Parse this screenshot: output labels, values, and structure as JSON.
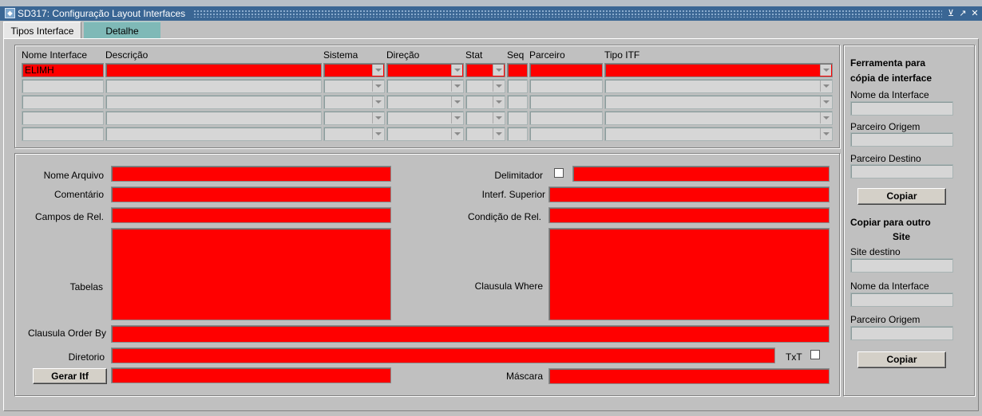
{
  "window": {
    "title": "SD317: Configuração Layout Interfaces"
  },
  "tabs": [
    {
      "label": "Tipos Interface"
    },
    {
      "label": "Detalhe"
    }
  ],
  "grid": {
    "columns": [
      "Nome Interface",
      "Descrição",
      "Sistema",
      "Direção",
      "Stat",
      "Seq",
      "Parceiro",
      "Tipo ITF"
    ],
    "first_row": {
      "nome_interface": "ELIMH"
    }
  },
  "detail": {
    "nome_arquivo_label": "Nome Arquivo",
    "comentario_label": "Comentário",
    "campos_rel_label": "Campos de Rel.",
    "tabelas_label": "Tabelas",
    "order_by_label": "Clausula Order By",
    "diretorio_label": "Diretorio",
    "gerar_button": "Gerar Itf",
    "delimitador_label": "Delimitador",
    "interf_superior_label": "Interf. Superior",
    "condicao_rel_label": "Condição de Rel.",
    "where_label": "Clausula Where",
    "txt_label": "TxT",
    "mascara_label": "Máscara"
  },
  "tool_copy": {
    "title_line1": "Ferramenta para",
    "title_line2": "cópia de interface",
    "nome_label": "Nome da Interface",
    "origem_label": "Parceiro Origem",
    "destino_label": "Parceiro Destino",
    "button": "Copiar"
  },
  "site_copy": {
    "title_line1": "Copiar para outro",
    "title_line2": "Site",
    "site_label": "Site destino",
    "nome_label": "Nome da Interface",
    "origem_label": "Parceiro Origem",
    "button": "Copiar"
  },
  "colors": {
    "required_field": "#ff0000",
    "titlebar": "#3a6694",
    "inactive_tab": "#7fb9b7"
  }
}
